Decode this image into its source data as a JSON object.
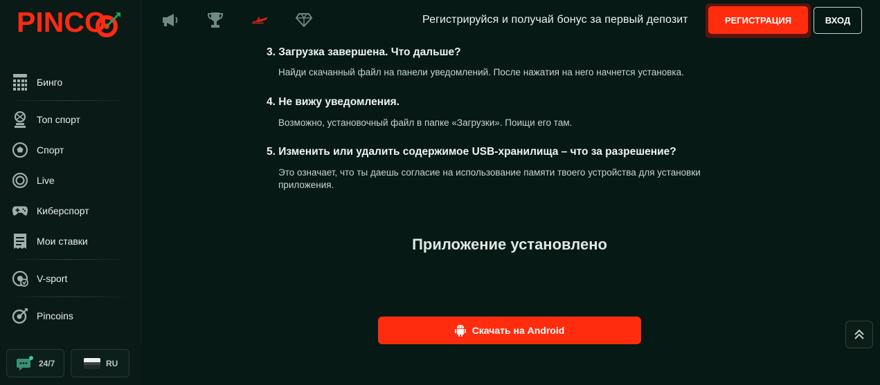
{
  "brand": {
    "logo_text": "PINCO",
    "accent_color": "#ff2d0e",
    "background_color": "#071914"
  },
  "sidebar": {
    "items": [
      {
        "label": "Бинго",
        "icon": "bingo-icon"
      },
      {
        "label": "Топ спорт",
        "icon": "top-sport-icon"
      },
      {
        "label": "Спорт",
        "icon": "soccer-ball-icon"
      },
      {
        "label": "Live",
        "icon": "live-icon"
      },
      {
        "label": "Киберспорт",
        "icon": "gamepad-icon"
      },
      {
        "label": "Мои ставки",
        "icon": "my-bets-icon"
      },
      {
        "label": "V-sport",
        "icon": "v-sport-icon"
      },
      {
        "label": "Pincoins",
        "icon": "pincoins-icon"
      }
    ],
    "support_label": "24/7",
    "language_label": "RU"
  },
  "header": {
    "nav_icons": [
      "megaphone-icon",
      "trophy-icon",
      "aviator-plane-icon",
      "diamond-icon"
    ],
    "promo_text": "Регистрируйся и получай бонус за первый депозит",
    "register_label": "РЕГИСТРАЦИЯ",
    "login_label": "ВХОД"
  },
  "faq": [
    {
      "question": "3. Загрузка завершена. Что дальше?",
      "answer": "Найди скачанный файл на панели уведомлений. После нажатия на него начнется установка."
    },
    {
      "question": "4. Не вижу уведомления.",
      "answer": "Возможно, установочный файл в папке «Загрузки». Поищи его там."
    },
    {
      "question": "5. Изменить или удалить содержимое USB-хранилища – что за разрешение?",
      "answer": "Это означает, что ты даешь согласие на использование памяти твоего устройства для установки приложения."
    }
  ],
  "main": {
    "installed_title": "Приложение установлено",
    "download_label": "Скачать на Android"
  }
}
